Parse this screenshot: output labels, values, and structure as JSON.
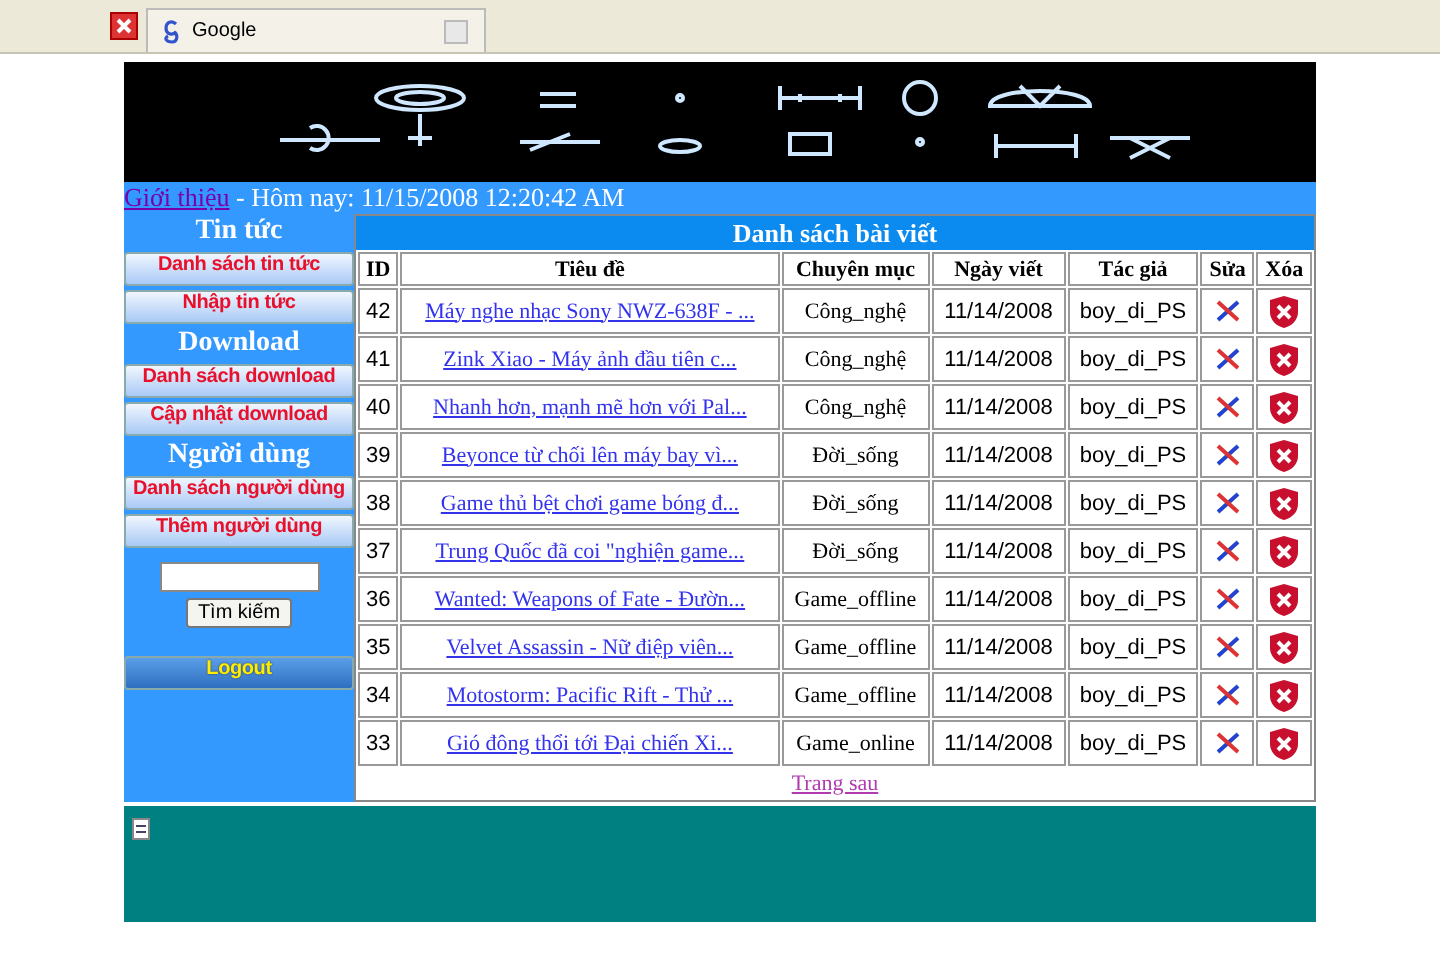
{
  "browser": {
    "tabs": [
      {
        "label": "Google",
        "selected": true
      }
    ]
  },
  "info_bar": {
    "link": "Giới thiệu",
    "text": "- Hôm nay: 11/15/2008 12:20:42 AM"
  },
  "sidebar": [
    {
      "kind": "heading",
      "label": "Tin tức"
    },
    {
      "kind": "link",
      "label": "Danh sách tin tức"
    },
    {
      "kind": "link",
      "label": "Nhập tin tức"
    },
    {
      "kind": "heading",
      "label": "Download"
    },
    {
      "kind": "link",
      "label": "Danh sách download"
    },
    {
      "kind": "link",
      "label": "Cập nhật download"
    },
    {
      "kind": "heading",
      "label": "Người dùng"
    },
    {
      "kind": "link",
      "label": "Danh sách người dùng"
    },
    {
      "kind": "link",
      "label": "Thêm người dùng"
    },
    {
      "kind": "search",
      "button": "Tìm kiếm"
    },
    {
      "kind": "logout",
      "label": "Logout"
    }
  ],
  "table": {
    "title": "Danh sách bài viết",
    "columns": [
      "ID",
      "Tiêu đề",
      "Chuyên mục",
      "Ngày viết",
      "Tác giả",
      "Sửa",
      "Xóa"
    ],
    "rows": [
      {
        "id": "42",
        "title": "Máy nghe nhạc Sony NWZ-638F - ...",
        "category": "Công_nghệ",
        "date": "11/14/2008",
        "author": "boy_di_PS"
      },
      {
        "id": "41",
        "title": "Zink Xiao - Máy ảnh đầu tiên c...",
        "category": "Công_nghệ",
        "date": "11/14/2008",
        "author": "boy_di_PS"
      },
      {
        "id": "40",
        "title": "Nhanh hơn, mạnh mẽ hơn với Pal...",
        "category": "Công_nghệ",
        "date": "11/14/2008",
        "author": "boy_di_PS"
      },
      {
        "id": "39",
        "title": "Beyonce từ chối lên máy bay vì...",
        "category": "Đời_sống",
        "date": "11/14/2008",
        "author": "boy_di_PS"
      },
      {
        "id": "38",
        "title": "Game thủ bệt chơi game bóng đ...",
        "category": "Đời_sống",
        "date": "11/14/2008",
        "author": "boy_di_PS"
      },
      {
        "id": "37",
        "title": "Trung Quốc đã coi \"nghiện game...",
        "category": "Đời_sống",
        "date": "11/14/2008",
        "author": "boy_di_PS"
      },
      {
        "id": "36",
        "title": "Wanted: Weapons of Fate - Đườn...",
        "category": "Game_offline",
        "date": "11/14/2008",
        "author": "boy_di_PS"
      },
      {
        "id": "35",
        "title": "Velvet Assassin - Nữ điệp viên...",
        "category": "Game_offline",
        "date": "11/14/2008",
        "author": "boy_di_PS"
      },
      {
        "id": "34",
        "title": "Motostorm: Pacific Rift - Thử ...",
        "category": "Game_offline",
        "date": "11/14/2008",
        "author": "boy_di_PS"
      },
      {
        "id": "33",
        "title": "Gió đông thổi tới Đại chiến Xi...",
        "category": "Game_online",
        "date": "11/14/2008",
        "author": "boy_di_PS"
      }
    ],
    "next_link": "Trang sau"
  }
}
